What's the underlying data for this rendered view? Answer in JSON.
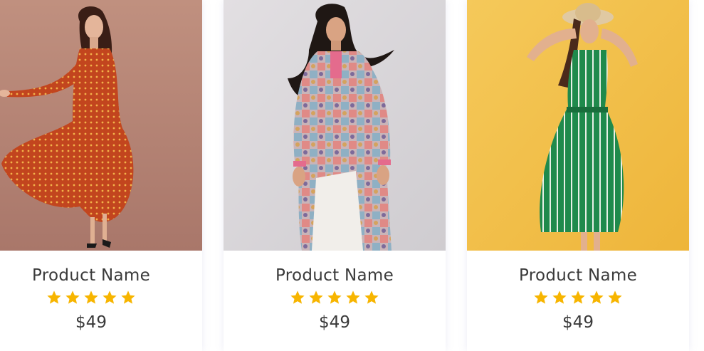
{
  "colors": {
    "star": "#f7b500",
    "text": "#3a3a3a",
    "card_background": "#ffffff"
  },
  "products": [
    {
      "name": "Product Name",
      "rating": 5,
      "price": "$49",
      "photo": "woman in red printed dress on brown backdrop",
      "backdrop": "#b9887a",
      "outfit": "#c2451e"
    },
    {
      "name": "Product Name",
      "rating": 5,
      "price": "$49",
      "photo": "woman in patterned kurta on grey backdrop",
      "backdrop": "#dcd9dc",
      "outfit": "#c98a86"
    },
    {
      "name": "Product Name",
      "rating": 5,
      "price": "$49",
      "photo": "woman in green striped dress on yellow backdrop",
      "backdrop": "#f2bd45",
      "outfit": "#1f8a4c"
    }
  ]
}
